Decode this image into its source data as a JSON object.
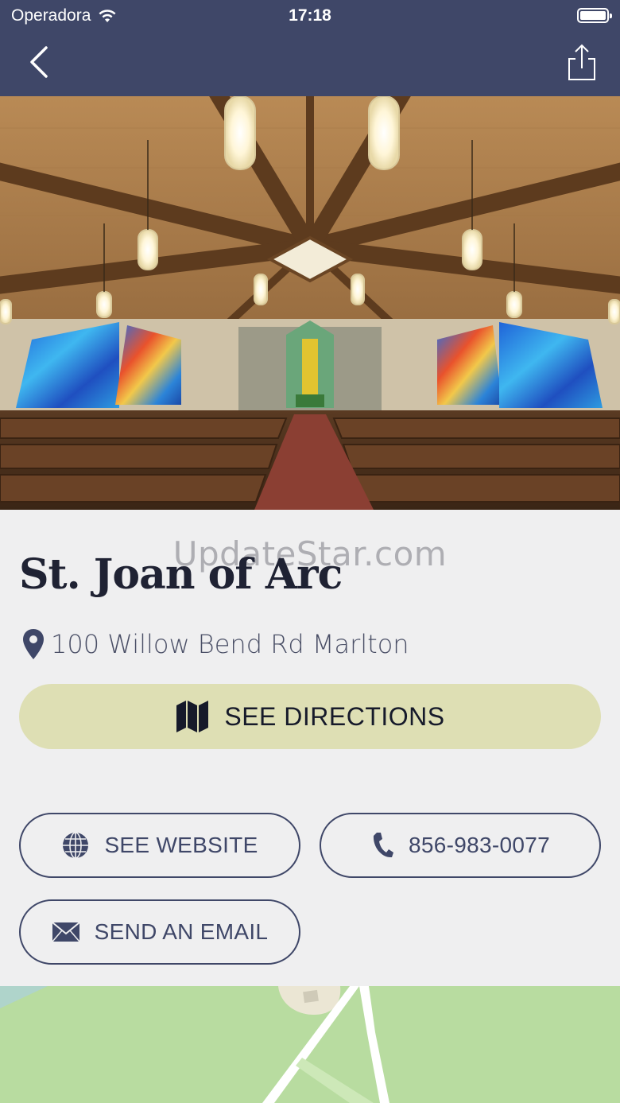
{
  "status_bar": {
    "carrier": "Operadora",
    "time": "17:18"
  },
  "nav": {
    "back_icon": "chevron-left-icon",
    "share_icon": "share-icon"
  },
  "watermark": "UpdateStar.com",
  "place": {
    "name": "St. Joan of Arc",
    "address": "100 Willow Bend Rd Marlton"
  },
  "actions": {
    "directions_label": "SEE DIRECTIONS",
    "website_label": "SEE WEBSITE",
    "phone_label": "856-983-0077",
    "email_label": "SEND AN EMAIL"
  },
  "colors": {
    "nav_bg": "#3f4768",
    "directions_bg": "#dedfb4",
    "page_bg": "#efeff0",
    "map_green": "#b8dca0"
  }
}
